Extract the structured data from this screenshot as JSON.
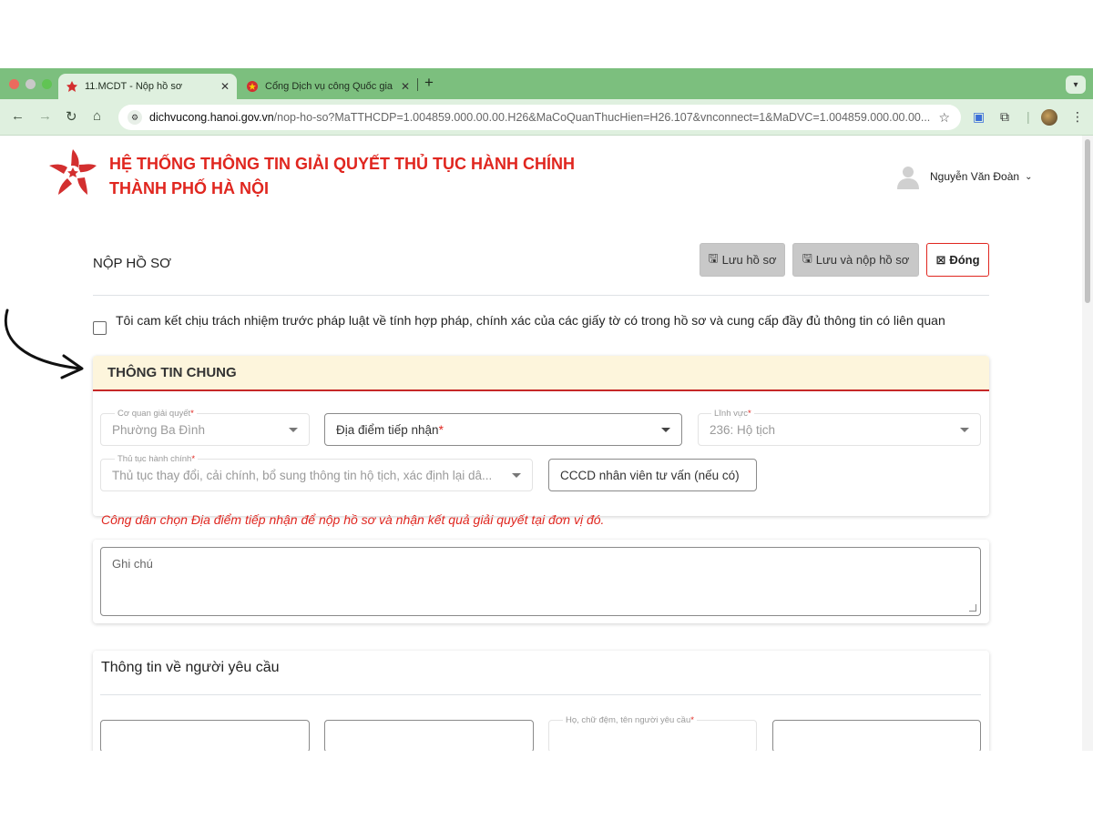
{
  "browser": {
    "tabs": [
      {
        "title": "11.MCDT - Nộp hồ sơ",
        "active": true
      },
      {
        "title": "Cổng Dịch vụ công Quốc gia",
        "active": false
      }
    ],
    "url_host": "dichvucong.hanoi.gov.vn",
    "url_path": "/nop-ho-so?MaTTHCDP=1.004859.000.00.00.H26&MaCoQuanThucHien=H26.107&vnconnect=1&MaDVC=1.004859.000.00.00...."
  },
  "header": {
    "title_line1": "HỆ THỐNG THÔNG TIN GIẢI QUYẾT THỦ TỤC HÀNH CHÍNH",
    "title_line2": "THÀNH PHỐ HÀ NỘI",
    "user_name": "Nguyễn Văn Đoàn"
  },
  "page": {
    "title": "NỘP HỒ SƠ",
    "buttons": {
      "save": "Lưu hồ sơ",
      "save_submit": "Lưu và nộp hồ sơ",
      "close": "Đóng"
    },
    "commitment": "Tôi cam kết chịu trách nhiệm trước pháp luật về tính hợp pháp, chính xác của các giấy tờ có trong hồ sơ và cung cấp đầy đủ thông tin có liên quan"
  },
  "general_info": {
    "heading": "THÔNG TIN CHUNG",
    "agency": {
      "label": "Cơ quan giải quyết",
      "value": "Phường Ba Đình"
    },
    "location": {
      "placeholder": "Địa điểm tiếp nhận"
    },
    "field": {
      "label": "Lĩnh vực",
      "value": "236: Hộ tịch"
    },
    "procedure": {
      "label": "Thủ tục hành chính",
      "value": "Thủ tục thay đổi, cải chính, bổ sung thông tin hộ tịch, xác định lại dâ..."
    },
    "consultant": {
      "placeholder": "CCCD nhân viên tư vấn (nếu có)"
    },
    "notice": "Công dân chọn Địa điểm tiếp nhận để nộp hồ sơ và nhận kết quả giải quyết tại đơn vị đó."
  },
  "notes": {
    "placeholder": "Ghi chú"
  },
  "requester": {
    "heading": "Thông tin về người yêu cầu",
    "fullname_label": "Họ, chữ đệm, tên người yêu cầu"
  },
  "colors": {
    "brand_red": "#e0261f",
    "tab_bar": "#7cbf7e",
    "header_bg": "#fdf5dc"
  }
}
